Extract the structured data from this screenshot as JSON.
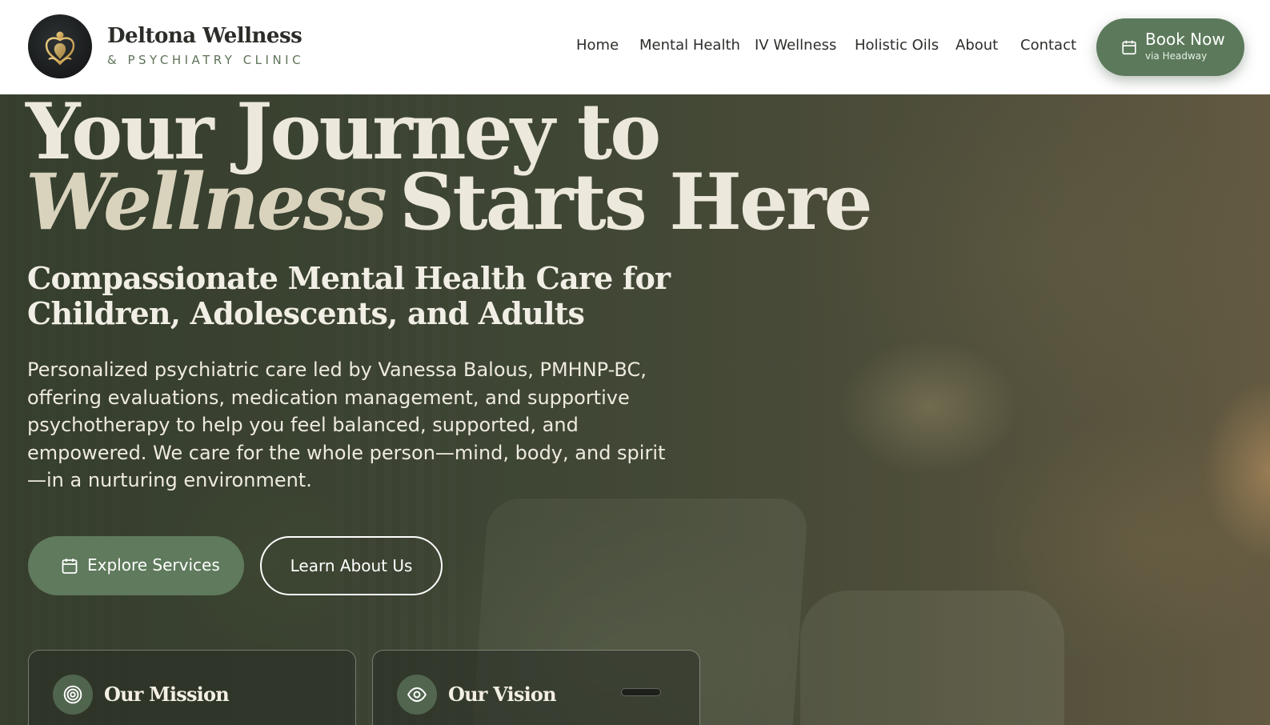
{
  "brand": {
    "name": "Deltona Wellness",
    "subtitle": "& PSYCHIATRY CLINIC",
    "logo_icon": "lotus-figure-icon"
  },
  "nav": {
    "items": [
      {
        "label": "Home"
      },
      {
        "label": "Mental Health"
      },
      {
        "label": "IV Wellness"
      },
      {
        "label": "Holistic Oils"
      },
      {
        "label": "About"
      },
      {
        "label": "Contact"
      }
    ],
    "book": {
      "label": "Book Now",
      "sub": "via Headway",
      "icon": "calendar-icon"
    }
  },
  "hero": {
    "headline_line1": "Your Journey to",
    "headline_accent": "Wellness",
    "headline_rest": "Starts Here",
    "subtitle": "Compassionate Mental Health Care for Children, Adolescents, and Adults",
    "description": "Personalized psychiatric care led by Vanessa Balous, PMHNP-BC, offering evaluations, medication management, and supportive psychotherapy to help you feel balanced, supported, and empowered. We care for the whole person—mind, body, and spirit—in a nurturing environment.",
    "primary_button": {
      "label": "Explore Services",
      "icon": "calendar-icon"
    },
    "secondary_button": {
      "label": "Learn About Us"
    }
  },
  "cards": [
    {
      "title": "Our Mission",
      "icon": "target-icon"
    },
    {
      "title": "Our Vision",
      "icon": "eye-icon"
    }
  ],
  "colors": {
    "accent_green": "#5c7a5b",
    "header_bg": "#ffffff",
    "headline_text": "#ece8dc",
    "brand_sub": "#5f7359"
  }
}
